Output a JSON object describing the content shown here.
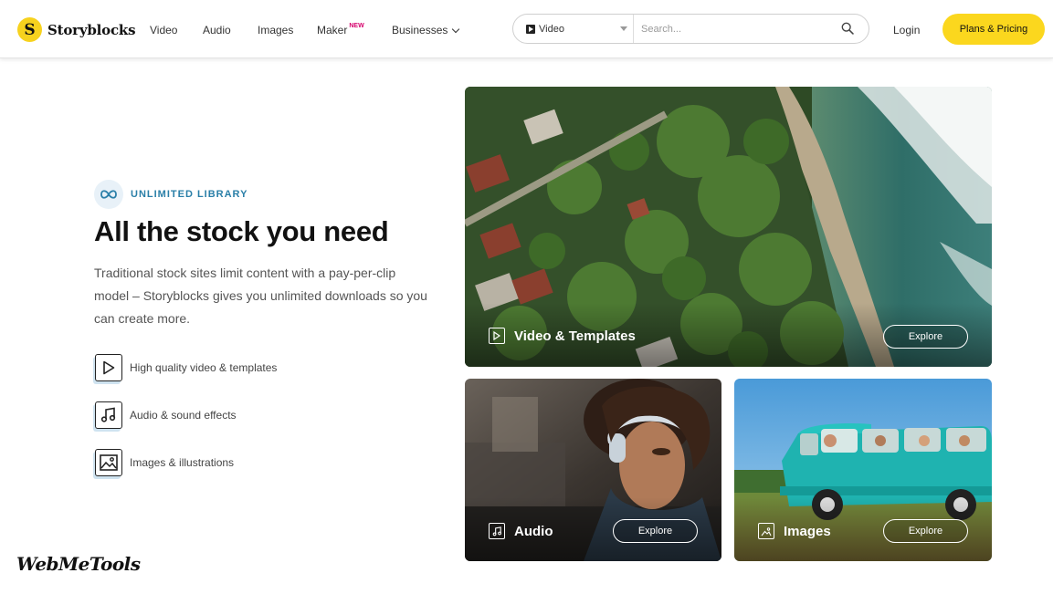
{
  "brand": {
    "name": "Storyblocks",
    "logo_letter": "S",
    "accent": "#fbd71e"
  },
  "nav": {
    "items": [
      {
        "label": "Video"
      },
      {
        "label": "Audio"
      },
      {
        "label": "Images"
      },
      {
        "label": "Maker",
        "badge": "NEW"
      },
      {
        "label": "Businesses"
      }
    ]
  },
  "search": {
    "media_type": "Video",
    "placeholder": "Search..."
  },
  "header": {
    "login": "Login",
    "plans": "Plans & Pricing"
  },
  "hero": {
    "eyebrow": "UNLIMITED LIBRARY",
    "title": "All the stock you need",
    "description": "Traditional stock sites limit content with a pay-per-clip model – Storyblocks gives you unlimited downloads so you can create more.",
    "features": [
      {
        "icon": "play-icon",
        "label": "High quality video & templates"
      },
      {
        "icon": "music-note-icon",
        "label": "Audio & sound effects"
      },
      {
        "icon": "image-icon",
        "label": "Images & illustrations"
      }
    ]
  },
  "cards": {
    "video": {
      "title": "Video & Templates",
      "cta": "Explore"
    },
    "audio": {
      "title": "Audio",
      "cta": "Explore"
    },
    "images": {
      "title": "Images",
      "cta": "Explore"
    }
  },
  "watermark": "WebMeTools"
}
